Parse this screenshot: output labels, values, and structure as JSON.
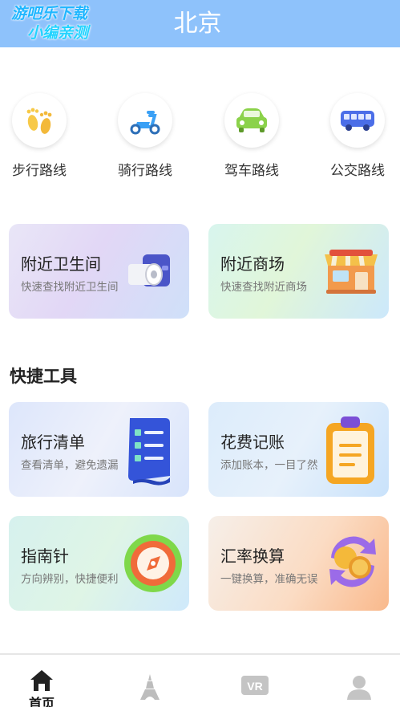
{
  "header": {
    "title": "北京",
    "watermark_line1": "游吧乐下载",
    "watermark_line2": "小编亲测"
  },
  "routes": [
    {
      "label": "步行路线",
      "icon": "footprints-icon",
      "color": "#f7c948"
    },
    {
      "label": "骑行路线",
      "icon": "scooter-icon",
      "color": "#3aa0f5"
    },
    {
      "label": "驾车路线",
      "icon": "car-icon",
      "color": "#8bd24a"
    },
    {
      "label": "公交路线",
      "icon": "bus-icon",
      "color": "#4b6ee8"
    }
  ],
  "nearby": [
    {
      "title": "附近卫生间",
      "subtitle": "快速查找附近卫生间",
      "icon": "toilet-paper-icon"
    },
    {
      "title": "附近商场",
      "subtitle": "快速查找附近商场",
      "icon": "shop-icon"
    }
  ],
  "tools_section": {
    "title": "快捷工具",
    "items": [
      {
        "title": "旅行清单",
        "subtitle": "查看清单，避免遗漏",
        "icon": "checklist-icon"
      },
      {
        "title": "花费记账",
        "subtitle": "添加账本，一目了然",
        "icon": "clipboard-icon"
      },
      {
        "title": "指南针",
        "subtitle": "方向辨别，快捷便利",
        "icon": "compass-icon"
      },
      {
        "title": "汇率换算",
        "subtitle": "一键换算，准确无误",
        "icon": "currency-exchange-icon"
      }
    ]
  },
  "tabbar": {
    "tabs": [
      {
        "label": "首页",
        "icon": "home-icon",
        "active": true
      },
      {
        "label": "",
        "icon": "eiffel-tower-icon",
        "active": false
      },
      {
        "label": "",
        "icon": "vr-icon",
        "active": false
      },
      {
        "label": "",
        "icon": "user-icon",
        "active": false
      }
    ]
  },
  "colors": {
    "header_bg": "#8ec2fb",
    "accent": "#3aa0f5"
  }
}
